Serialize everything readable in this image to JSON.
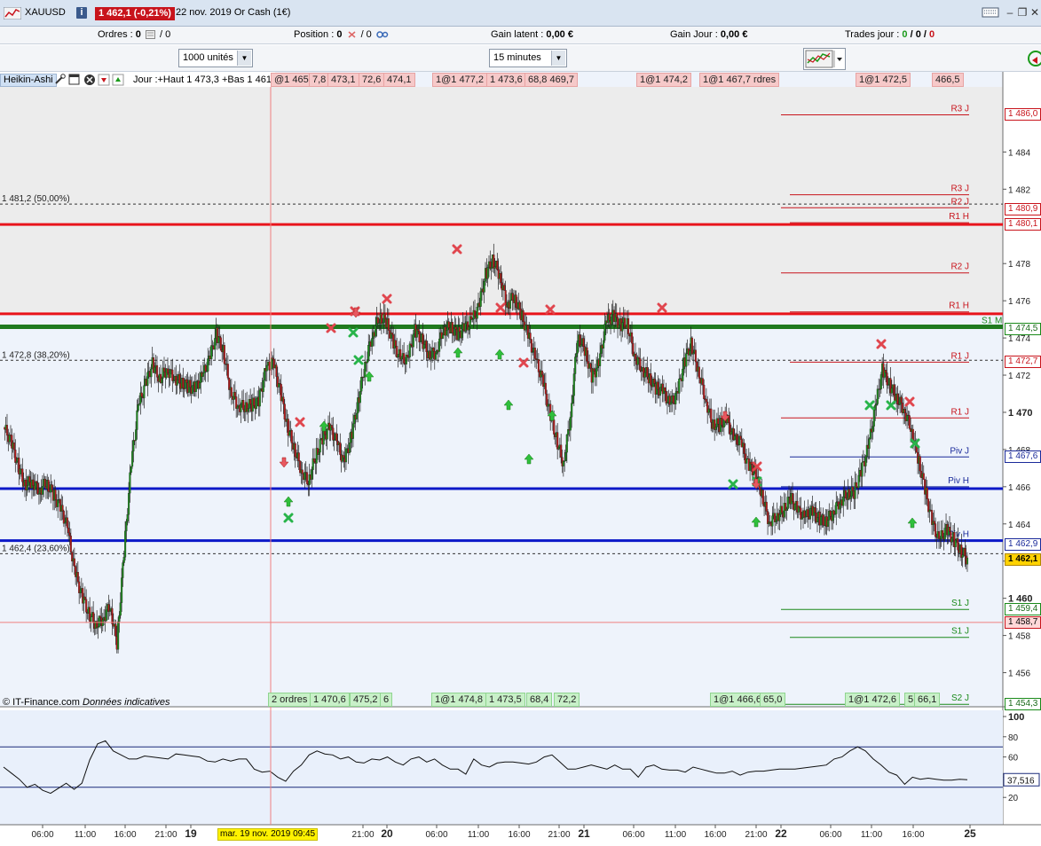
{
  "window": {
    "symbol": "XAUUSD",
    "price_badge": "1 462,1 (-0,21%)",
    "date_text": "22 nov. 2019 Or Cash (1€)"
  },
  "toolbar": {
    "orders_label": "Ordres :",
    "orders_value": "0",
    "orders_value2": "/ 0",
    "position_label": "Position :",
    "position_value": "0",
    "position_value2": "/ 0",
    "latent_label": "Gain latent :",
    "latent_value": "0,00 €",
    "daygain_label": "Gain Jour :",
    "daygain_value": "0,00 €",
    "trades_label": "Trades jour :",
    "trades_values": [
      "0",
      "/",
      "0",
      "/",
      "0"
    ]
  },
  "selectors": {
    "quantity": "1000 unités",
    "timeframe": "15 minutes"
  },
  "indicator_bar": {
    "name": "Heikin-Ashi",
    "description": "Jour :+Haut 1 473,3 +Bas 1 461"
  },
  "top_order_tags": [
    "@1 465,1",
    "7,8",
    "473,1",
    "72,6",
    "474,1",
    "1@1 477,2",
    "1 473,6",
    "68,8 469,7",
    "1@1 474,2",
    "1@1 467,7 rdres",
    "1@1 472,5",
    "466,5"
  ],
  "bottom_order_tags": [
    "2 ordres",
    "1 470,6",
    "475,2",
    "6",
    "1@1 474,8",
    "1 473,5",
    "68,4",
    "72,2",
    "1@1 466,6",
    "65,0",
    "1@1 472,6",
    "5",
    "66,1"
  ],
  "copyright": "© IT-Finance.com",
  "copyright_note": "Données indicatives",
  "cursor_date": "mar. 19 nov. 2019 09:45",
  "colors": {
    "red_level": "#e8141c",
    "blue_level": "#0c18c8",
    "green_level": "#1f7a1f",
    "pivot_blue": "#1a2a9a"
  },
  "chart_data": {
    "type": "candlestick",
    "y_range": [
      1454.5,
      1487.5
    ],
    "y_ticks": [
      1456,
      1458,
      1460,
      1462,
      1464,
      1466,
      1468,
      1470,
      1472,
      1474,
      1476,
      1478,
      1482,
      1484
    ],
    "y_tick_labels": [
      "1 456",
      "1 458",
      "1 460",
      "1 462",
      "1 464",
      "1 466",
      "1 468",
      "1 470",
      "1 472",
      "1 474",
      "1 476",
      "1 478",
      "1 482",
      "1 484"
    ],
    "x_tick_labels": [
      "06:00",
      "11:00",
      "16:00",
      "21:00",
      "19",
      "",
      "21:00",
      "20",
      "06:00",
      "11:00",
      "16:00",
      "21:00",
      "21",
      "06:00",
      "11:00",
      "16:00",
      "21:00",
      "22",
      "06:00",
      "11:00",
      "16:00",
      "25"
    ],
    "fib_levels": [
      {
        "label": "1 481,2 (50,00%)",
        "value": 1481.2
      },
      {
        "label": "1 472,8 (38,20%)",
        "value": 1472.8
      },
      {
        "label": "1 462,4 (23,60%)",
        "value": 1462.4
      }
    ],
    "horizontal_lines": [
      {
        "value": 1480.1,
        "kind": "red"
      },
      {
        "value": 1475.3,
        "kind": "red"
      },
      {
        "value": 1474.6,
        "kind": "green"
      },
      {
        "value": 1465.9,
        "kind": "blue"
      },
      {
        "value": 1463.1,
        "kind": "blue"
      }
    ],
    "pivot_labels": [
      {
        "label": "R3 J",
        "value": 1486.0,
        "color": "red"
      },
      {
        "label": "R3 J",
        "value": 1481.7,
        "color": "red"
      },
      {
        "label": "R2 J",
        "value": 1481.0,
        "color": "red"
      },
      {
        "label": "R1 H",
        "value": 1480.2,
        "color": "red"
      },
      {
        "label": "R2 J",
        "value": 1477.5,
        "color": "red"
      },
      {
        "label": "R1 H",
        "value": 1475.4,
        "color": "red"
      },
      {
        "label": "S1 M",
        "value": 1474.6,
        "color": "green"
      },
      {
        "label": "R1 J",
        "value": 1472.7,
        "color": "red"
      },
      {
        "label": "R1 J",
        "value": 1469.7,
        "color": "red"
      },
      {
        "label": "Piv J",
        "value": 1467.6,
        "color": "blue"
      },
      {
        "label": "Piv H",
        "value": 1466.0,
        "color": "blue"
      },
      {
        "label": "Piv H",
        "value": 1463.1,
        "color": "blue"
      },
      {
        "label": "S1 J",
        "value": 1459.4,
        "color": "green"
      },
      {
        "label": "S1 J",
        "value": 1457.9,
        "color": "green"
      },
      {
        "label": "S2 J",
        "value": 1454.3,
        "color": "green"
      }
    ],
    "axis_boxes": [
      {
        "text": "1 486,0",
        "value": 1486.0,
        "style": "red"
      },
      {
        "text": "1 480,9",
        "value": 1480.9,
        "style": "red"
      },
      {
        "text": "1 480,1",
        "value": 1480.1,
        "style": "red"
      },
      {
        "text": "1 474,5",
        "value": 1474.5,
        "style": "green"
      },
      {
        "text": "1 472,7",
        "value": 1472.7,
        "style": "red"
      },
      {
        "text": "1 467,6",
        "value": 1467.6,
        "style": "blue"
      },
      {
        "text": "1 462,9",
        "value": 1462.9,
        "style": "blue"
      },
      {
        "text": "1 462,1",
        "value": 1462.1,
        "style": "current"
      },
      {
        "text": "1 459,4",
        "value": 1459.4,
        "style": "green"
      },
      {
        "text": "1 458,7",
        "value": 1458.7,
        "style": "redfill"
      },
      {
        "text": "1 454,3",
        "value": 1454.3,
        "style": "green"
      }
    ],
    "price_series": [
      1469.2,
      1468.5,
      1467.2,
      1466.1,
      1466.3,
      1465.8,
      1466.2,
      1465.6,
      1464.9,
      1463.8,
      1461.5,
      1460.2,
      1459.2,
      1458.6,
      1458.9,
      1459.6,
      1457.6,
      1462.5,
      1467.2,
      1470.3,
      1471.5,
      1472.6,
      1471.8,
      1472.3,
      1471.9,
      1471.6,
      1471.4,
      1471.3,
      1471.9,
      1472.8,
      1474.2,
      1473.3,
      1471.2,
      1470.4,
      1470.3,
      1470.4,
      1470.6,
      1472.3,
      1472.7,
      1471.2,
      1469.3,
      1468.1,
      1466.9,
      1466.3,
      1467.6,
      1468.6,
      1469.2,
      1468.4,
      1467.3,
      1468.6,
      1470.5,
      1472.6,
      1474.1,
      1475.1,
      1474.9,
      1473.7,
      1472.9,
      1472.8,
      1474.4,
      1473.9,
      1473.1,
      1473.2,
      1474.4,
      1474.6,
      1474.2,
      1474.5,
      1474.9,
      1475.6,
      1477.4,
      1478.2,
      1477.4,
      1475.8,
      1476.2,
      1475.3,
      1474.2,
      1472.9,
      1471.8,
      1470.1,
      1468.6,
      1467.2,
      1469.8,
      1474.1,
      1473.4,
      1471.9,
      1472.6,
      1474.8,
      1475.2,
      1474.7,
      1474.8,
      1473.1,
      1472.4,
      1471.9,
      1471.3,
      1471.2,
      1470.4,
      1470.9,
      1472.6,
      1473.7,
      1472.3,
      1470.8,
      1469.4,
      1469.3,
      1469.7,
      1468.6,
      1468.4,
      1467.2,
      1466.8,
      1465.6,
      1464.1,
      1464.4,
      1464.7,
      1465.4,
      1464.8,
      1464.3,
      1464.7,
      1464.3,
      1464.1,
      1464.6,
      1465.2,
      1465.6,
      1465.7,
      1466.8,
      1468.1,
      1470.2,
      1472.3,
      1471.5,
      1470.8,
      1470.2,
      1469.2,
      1467.6,
      1465.9,
      1464.1,
      1463.1,
      1463.7,
      1463.2,
      1462.6,
      1462.1
    ]
  },
  "oscillator": {
    "y_ticks": [
      "100",
      "80",
      "60",
      "40",
      "20"
    ],
    "current_value": "37,516",
    "upper_level": 70,
    "lower_level": 30,
    "series": [
      50,
      44,
      38,
      30,
      33,
      27,
      24,
      29,
      34,
      28,
      34,
      57,
      73,
      76,
      66,
      62,
      58,
      58,
      61,
      60,
      59,
      58,
      63,
      62,
      61,
      60,
      56,
      55,
      58,
      56,
      58,
      58,
      48,
      45,
      46,
      40,
      36,
      46,
      52,
      62,
      66,
      63,
      62,
      58,
      60,
      55,
      54,
      58,
      57,
      60,
      55,
      52,
      58,
      60,
      55,
      58,
      52,
      48,
      48,
      43,
      58,
      52,
      50,
      54,
      55,
      55,
      54,
      53,
      55,
      60,
      62,
      55,
      48,
      48,
      50,
      52,
      50,
      48,
      52,
      48,
      48,
      40,
      50,
      52,
      48,
      47,
      47,
      45,
      50,
      48,
      46,
      44,
      44,
      46,
      42,
      45,
      46,
      46,
      47,
      48,
      48,
      48,
      49,
      50,
      51,
      52,
      58,
      60,
      66,
      70,
      66,
      58,
      52,
      45,
      42,
      33,
      40,
      38,
      39,
      38,
      37,
      37,
      38,
      37.5
    ]
  }
}
